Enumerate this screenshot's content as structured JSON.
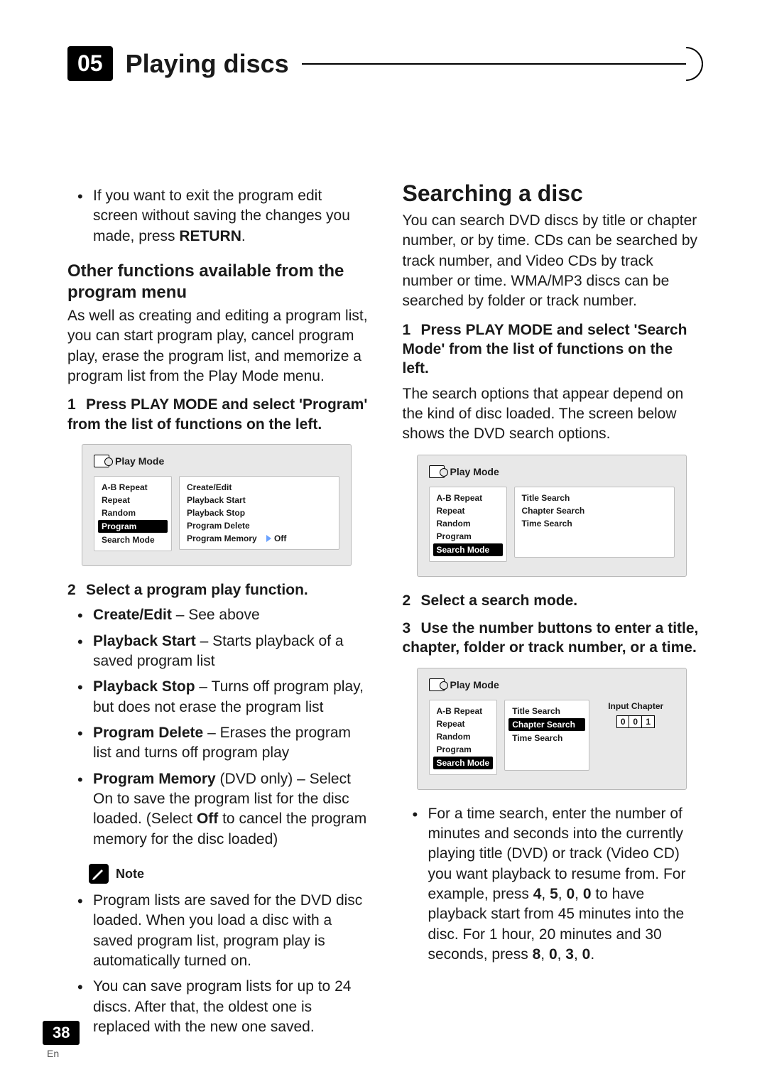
{
  "header": {
    "chapter_number": "05",
    "chapter_title": "Playing discs"
  },
  "left": {
    "intro_bullet": {
      "pre": "If you want to exit the program edit screen without saving the changes you made, press ",
      "bold": "RETURN",
      "post": "."
    },
    "h_other": "Other functions available from the program menu",
    "p_other": "As well as creating and editing a program list, you can start program play, cancel program play, erase the program list, and memorize a program list from the Play Mode menu.",
    "step1": {
      "num": "1",
      "text": "Press PLAY MODE and select 'Program' from the list of functions on the left."
    },
    "ui1": {
      "title": "Play Mode",
      "left_items": [
        "A-B Repeat",
        "Repeat",
        "Random",
        "Program",
        "Search Mode"
      ],
      "left_selected_index": 3,
      "right_items": [
        "Create/Edit",
        "Playback Start",
        "Playback Stop",
        "Program Delete",
        "Program Memory"
      ],
      "right_trailing": "Off"
    },
    "step2": {
      "num": "2",
      "text": "Select a program play function."
    },
    "func_bullets": [
      {
        "bold": "Create/Edit",
        "rest": " – See above"
      },
      {
        "bold": "Playback Start",
        "rest": " – Starts playback of a saved program list"
      },
      {
        "bold": "Playback Stop",
        "rest": " – Turns off program play, but does not erase the program list"
      },
      {
        "bold": "Program Delete",
        "rest": " – Erases the program list and turns off program play"
      },
      {
        "bold": "Program Memory",
        "mid": " (DVD only) – Select On to save the program list for the disc loaded. (Select ",
        "bold2": "Off",
        "rest": " to cancel the program memory for the disc loaded)"
      }
    ],
    "note_label": "Note",
    "note_bullets": [
      "Program lists are saved for the DVD disc loaded. When you load a disc with a saved program list, program play is automatically turned on.",
      "You can save program lists for up to 24 discs. After that, the oldest one is replaced with the new one saved."
    ]
  },
  "right": {
    "h_search": "Searching a disc",
    "p_search": "You can search DVD discs by title or chapter number, or by time. CDs can be searched by track number, and Video CDs by track number or time. WMA/MP3 discs can be searched by folder or track number.",
    "step1": {
      "num": "1",
      "text": "Press PLAY MODE and select 'Search Mode' from the list of functions on the left."
    },
    "p_after1": "The search options that appear depend on the kind of disc loaded. The screen below shows the DVD search options.",
    "ui2": {
      "title": "Play Mode",
      "left_items": [
        "A-B Repeat",
        "Repeat",
        "Random",
        "Program",
        "Search Mode"
      ],
      "left_selected_index": 4,
      "right_items": [
        "Title Search",
        "Chapter Search",
        "Time Search"
      ]
    },
    "step2": {
      "num": "2",
      "text": "Select a search mode."
    },
    "step3": {
      "num": "3",
      "text": "Use the number buttons to enter a title, chapter, folder or track number, or a time."
    },
    "ui3": {
      "title": "Play Mode",
      "left_items": [
        "A-B Repeat",
        "Repeat",
        "Random",
        "Program",
        "Search Mode"
      ],
      "left_selected_index": 4,
      "right_items": [
        "Title Search",
        "Chapter Search",
        "Time Search"
      ],
      "right_selected_index": 1,
      "input_label": "Input Chapter",
      "input_digits": [
        "0",
        "0",
        "1"
      ]
    },
    "time_bullet": {
      "pre": "For a time search, enter the number of minutes and seconds into the currently playing title (DVD) or track (Video CD) you want playback to resume from. For example, press ",
      "seq1": [
        "4",
        "5",
        "0",
        "0"
      ],
      "mid": " to have playback start from 45 minutes into the disc. For 1 hour, 20 minutes and 30 seconds, press ",
      "seq2": [
        "8",
        "0",
        "3",
        "0"
      ],
      "post": "."
    }
  },
  "footer": {
    "page": "38",
    "lang": "En"
  }
}
